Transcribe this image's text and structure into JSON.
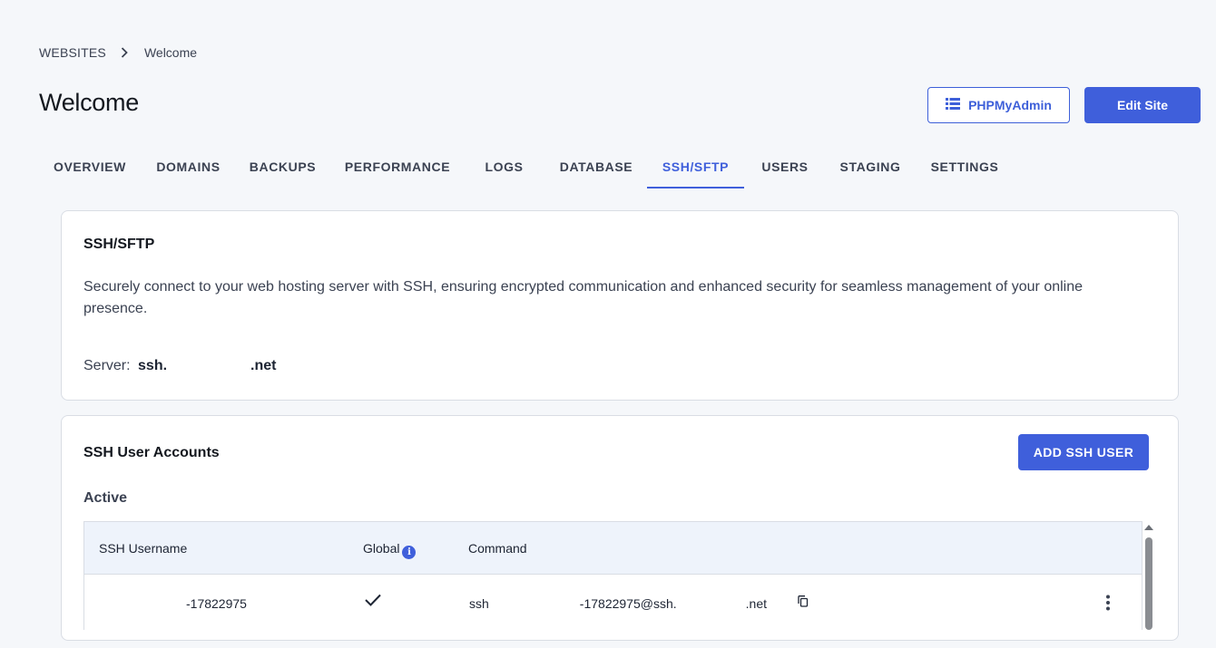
{
  "breadcrumb": {
    "root": "WEBSITES",
    "current": "Welcome"
  },
  "page": {
    "title": "Welcome"
  },
  "header_actions": {
    "phpmyadmin_label": "PHPMyAdmin",
    "edit_site_label": "Edit Site"
  },
  "tabs": [
    {
      "label": "OVERVIEW"
    },
    {
      "label": "DOMAINS"
    },
    {
      "label": "BACKUPS"
    },
    {
      "label": "PERFORMANCE"
    },
    {
      "label": "LOGS"
    },
    {
      "label": "DATABASE"
    },
    {
      "label": "SSH/SFTP",
      "active": true
    },
    {
      "label": "USERS"
    },
    {
      "label": "STAGING"
    },
    {
      "label": "SETTINGS"
    }
  ],
  "ssh_card": {
    "title": "SSH/SFTP",
    "description": "Securely connect to your web hosting server with SSH, ensuring encrypted communication and enhanced security for seamless management of your online presence.",
    "server_label": "Server:",
    "server_prefix": "ssh.",
    "server_suffix": ".net"
  },
  "accounts_card": {
    "title": "SSH User Accounts",
    "add_button": "ADD SSH USER",
    "section_label": "Active",
    "columns": {
      "username": "SSH Username",
      "global": "Global",
      "command": "Command"
    },
    "rows": [
      {
        "username": "-17822975",
        "command_prefix": "ssh",
        "command_user": "-17822975@ssh.",
        "command_suffix": ".net"
      }
    ]
  },
  "colors": {
    "accent": "#3f5fdb",
    "background": "#f5f7fa",
    "table_header": "#eef3fb"
  }
}
